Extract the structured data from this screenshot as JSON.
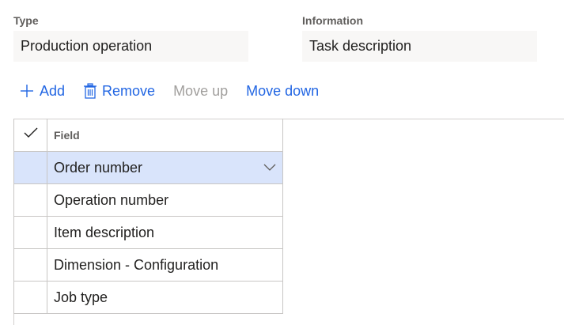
{
  "type_field": {
    "label": "Type",
    "value": "Production operation"
  },
  "information_field": {
    "label": "Information",
    "value": "Task description"
  },
  "toolbar": {
    "add_label": "Add",
    "remove_label": "Remove",
    "move_up_label": "Move up",
    "move_down_label": "Move down"
  },
  "grid": {
    "header": "Field",
    "rows": [
      {
        "field": "Order number",
        "selected": true
      },
      {
        "field": "Operation number",
        "selected": false
      },
      {
        "field": "Item description",
        "selected": false
      },
      {
        "field": "Dimension - Configuration",
        "selected": false
      },
      {
        "field": "Job type",
        "selected": false
      }
    ]
  },
  "colors": {
    "accent": "#2266e3",
    "disabled": "#a19f9d",
    "selected_row": "#d9e4fb",
    "input_bg": "#f8f7f6"
  },
  "icons": {
    "add": "plus-icon",
    "remove": "trash-icon",
    "header_check": "checkmark-icon",
    "row_dropdown": "chevron-down-icon"
  }
}
